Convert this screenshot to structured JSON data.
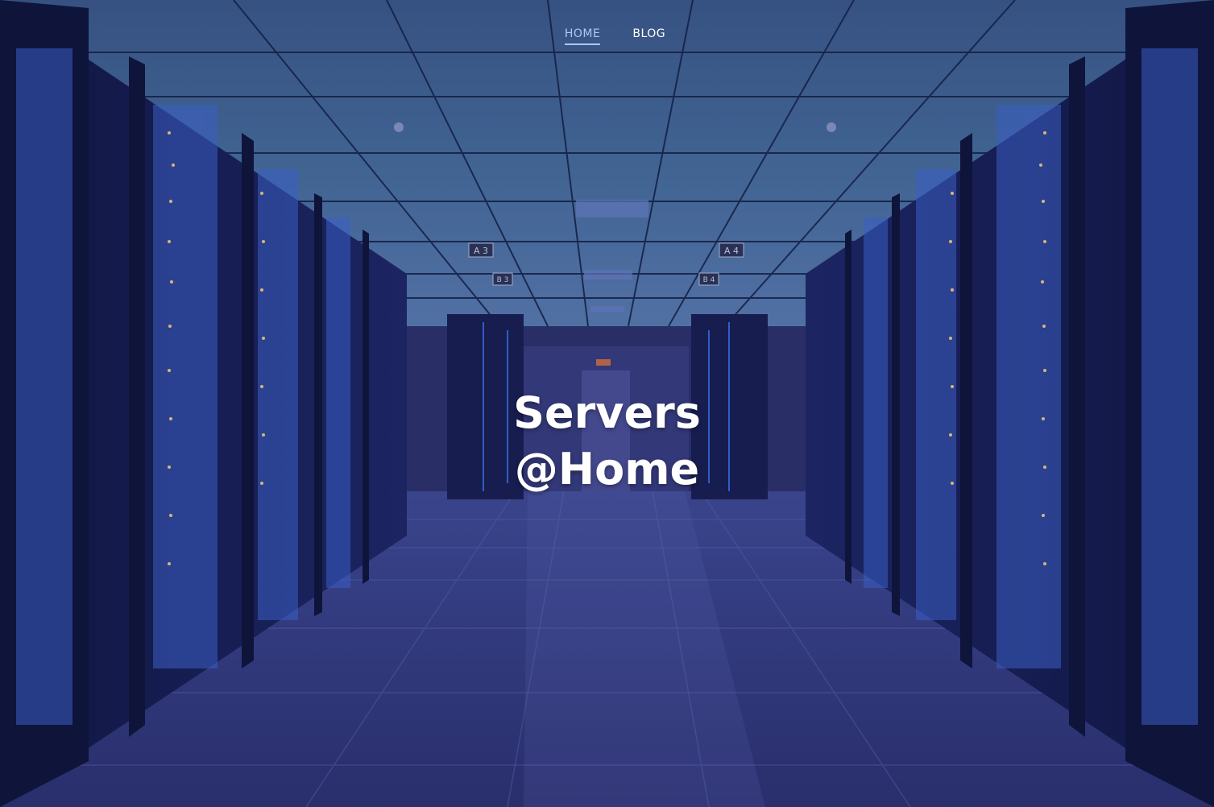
{
  "nav": {
    "items": [
      {
        "label": "HOME",
        "active": true
      },
      {
        "label": "BLOG",
        "active": false
      }
    ],
    "active_color": "#a9c8ff",
    "text_color": "#ffffff"
  },
  "hero": {
    "title_line1": "Servers",
    "title_line2": "@Home",
    "background": "server-room-corridor-image",
    "signs": [
      "A 3",
      "B 3",
      "A 4",
      "B 4"
    ]
  }
}
